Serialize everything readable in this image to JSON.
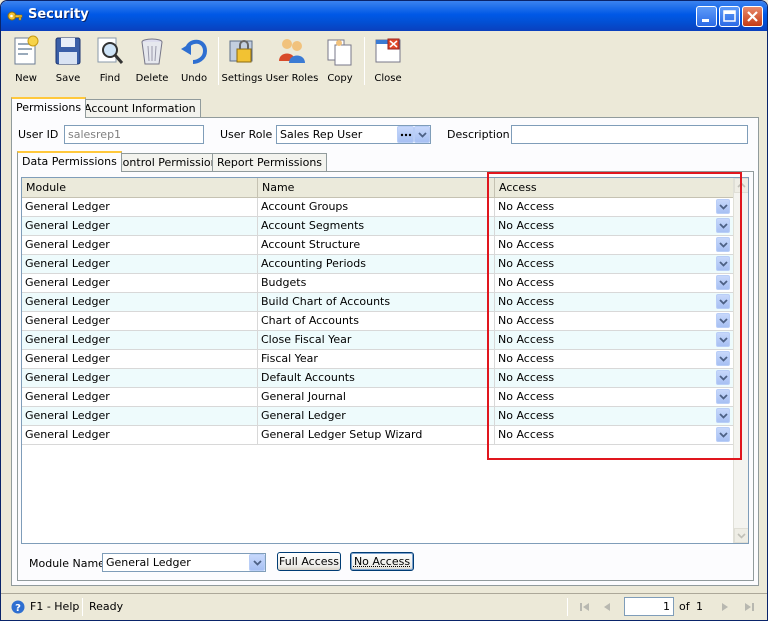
{
  "window": {
    "title": "Security"
  },
  "toolbar": {
    "items": [
      {
        "label": "New",
        "icon": "new-record-icon"
      },
      {
        "label": "Save",
        "icon": "floppy-disk-icon"
      },
      {
        "label": "Find",
        "icon": "binoculars-icon"
      },
      {
        "label": "Delete",
        "icon": "trash-can-icon"
      },
      {
        "label": "Undo",
        "icon": "undo-arrow-icon"
      },
      {
        "label": "Settings",
        "icon": "settings-icon"
      },
      {
        "label": "User Roles",
        "icon": "user-roles-icon"
      },
      {
        "label": "Copy",
        "icon": "copy-icon"
      },
      {
        "label": "Close",
        "icon": "close-window-icon"
      }
    ]
  },
  "tabs_top": [
    {
      "label": "Permissions",
      "active": true
    },
    {
      "label": "Account Information",
      "active": false
    }
  ],
  "form": {
    "user_id_label": "User ID",
    "user_id_value": "salesrep1",
    "user_role_label": "User Role",
    "user_role_value": "Sales Rep User",
    "description_label": "Description",
    "description_value": ""
  },
  "tabs_inner": [
    {
      "label": "Data Permissions",
      "active": true
    },
    {
      "label": "Control Permissions",
      "active": false
    },
    {
      "label": "Report Permissions",
      "active": false
    }
  ],
  "grid": {
    "columns": [
      "Module",
      "Name",
      "Access"
    ],
    "rows": [
      {
        "module": "General Ledger",
        "name": "Account Groups",
        "access": "No Access"
      },
      {
        "module": "General Ledger",
        "name": "Account Segments",
        "access": "No Access"
      },
      {
        "module": "General Ledger",
        "name": "Account Structure",
        "access": "No Access"
      },
      {
        "module": "General Ledger",
        "name": "Accounting Periods",
        "access": "No Access"
      },
      {
        "module": "General Ledger",
        "name": "Budgets",
        "access": "No Access"
      },
      {
        "module": "General Ledger",
        "name": "Build Chart of Accounts",
        "access": "No Access"
      },
      {
        "module": "General Ledger",
        "name": "Chart of Accounts",
        "access": "No Access"
      },
      {
        "module": "General Ledger",
        "name": "Close Fiscal Year",
        "access": "No Access"
      },
      {
        "module": "General Ledger",
        "name": "Fiscal Year",
        "access": "No Access"
      },
      {
        "module": "General Ledger",
        "name": "Default Accounts",
        "access": "No Access"
      },
      {
        "module": "General Ledger",
        "name": "General Journal",
        "access": "No Access"
      },
      {
        "module": "General Ledger",
        "name": "General Ledger",
        "access": "No Access"
      },
      {
        "module": "General Ledger",
        "name": "General Ledger Setup Wizard",
        "access": "No Access"
      }
    ]
  },
  "bottom": {
    "module_name_label": "Module Name",
    "module_name_value": "General Ledger",
    "full_access_label": "Full Access",
    "no_access_label": "No Access"
  },
  "status": {
    "help_label": "F1 - Help",
    "status_text": "Ready",
    "page_current": "1",
    "page_of": "of",
    "page_total": "1"
  },
  "colors": {
    "title_bar": "#0058e6",
    "highlight_box": "#e0161e",
    "alt_row": "#eefbfc"
  }
}
